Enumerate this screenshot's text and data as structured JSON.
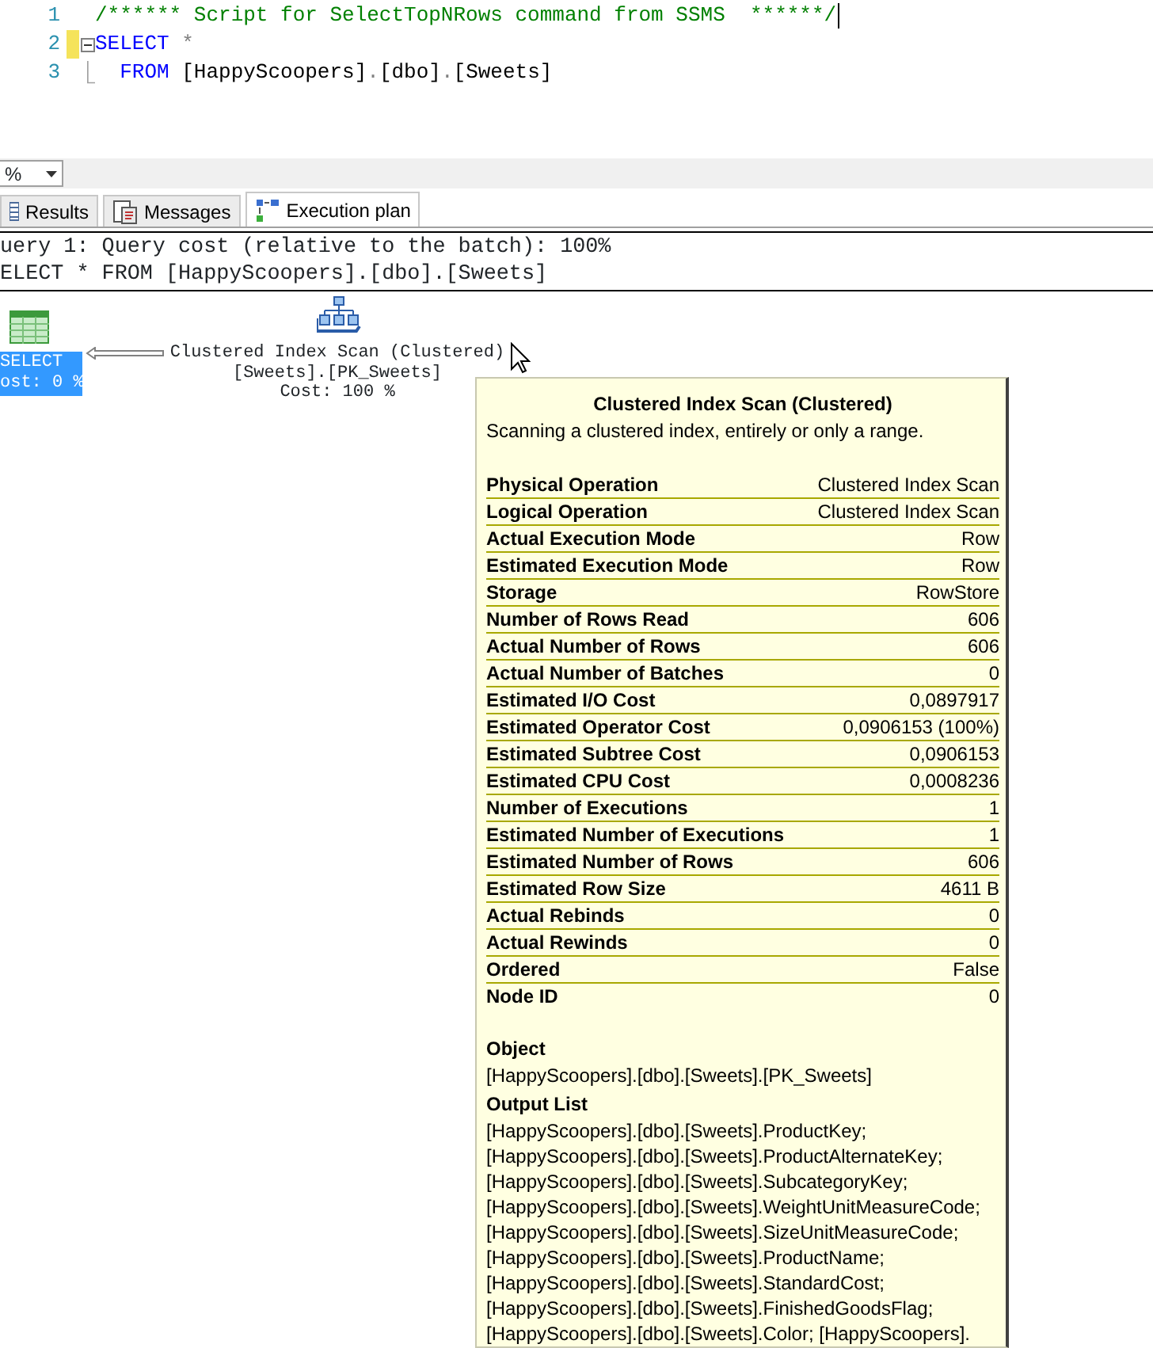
{
  "editor": {
    "lines": [
      {
        "number": "1",
        "modified": false,
        "collapse_box": false,
        "fold_guide": false,
        "caret": true,
        "segments": [
          {
            "kind": "comment",
            "text": "/****** Script for SelectTopNRows command from SSMS  ******/"
          }
        ]
      },
      {
        "number": "2",
        "modified": true,
        "collapse_box": true,
        "fold_guide": false,
        "caret": false,
        "segments": [
          {
            "kind": "keyword",
            "text": "SELECT"
          },
          {
            "kind": "operator",
            "text": " *"
          }
        ]
      },
      {
        "number": "3",
        "modified": false,
        "collapse_box": false,
        "fold_guide": true,
        "caret": false,
        "segments": [
          {
            "kind": "keyword",
            "text": "  FROM"
          },
          {
            "kind": "identifier",
            "text": " [HappyScoopers]"
          },
          {
            "kind": "operator",
            "text": "."
          },
          {
            "kind": "identifier",
            "text": "[dbo]"
          },
          {
            "kind": "operator",
            "text": "."
          },
          {
            "kind": "identifier",
            "text": "[Sweets]"
          }
        ]
      }
    ]
  },
  "zoom": {
    "value": "%"
  },
  "tabs": [
    {
      "label": "Results",
      "selected": false,
      "kind": "grid"
    },
    {
      "label": "Messages",
      "selected": false,
      "kind": "messages"
    },
    {
      "label": "Execution plan",
      "selected": true,
      "kind": "plan"
    }
  ],
  "plan": {
    "header": [
      "uery 1: Query cost (relative to the batch): 100%",
      "ELECT * FROM [HappyScoopers].[dbo].[Sweets]"
    ],
    "nodes": [
      {
        "kind": "select",
        "selected": true,
        "lines": [
          "SELECT",
          "ost: 0 %"
        ]
      },
      {
        "kind": "scan",
        "selected": false,
        "lines": [
          "Clustered Index Scan (Clustered)",
          "[Sweets].[PK_Sweets]",
          "Cost: 100 %"
        ]
      }
    ]
  },
  "tooltip": {
    "title": "Clustered Index Scan (Clustered)",
    "description": "Scanning a clustered index, entirely or only a range.",
    "properties": [
      {
        "label": "Physical Operation",
        "value": "Clustered Index Scan"
      },
      {
        "label": "Logical Operation",
        "value": "Clustered Index Scan"
      },
      {
        "label": "Actual Execution Mode",
        "value": "Row"
      },
      {
        "label": "Estimated Execution Mode",
        "value": "Row"
      },
      {
        "label": "Storage",
        "value": "RowStore"
      },
      {
        "label": "Number of Rows Read",
        "value": "606"
      },
      {
        "label": "Actual Number of Rows",
        "value": "606"
      },
      {
        "label": "Actual Number of Batches",
        "value": "0"
      },
      {
        "label": "Estimated I/O Cost",
        "value": "0,0897917"
      },
      {
        "label": "Estimated Operator Cost",
        "value": "0,0906153 (100%)"
      },
      {
        "label": "Estimated Subtree Cost",
        "value": "0,0906153"
      },
      {
        "label": "Estimated CPU Cost",
        "value": "0,0008236"
      },
      {
        "label": "Number of Executions",
        "value": "1"
      },
      {
        "label": "Estimated Number of Executions",
        "value": "1"
      },
      {
        "label": "Estimated Number of Rows",
        "value": "606"
      },
      {
        "label": "Estimated Row Size",
        "value": "4611 B"
      },
      {
        "label": "Actual Rebinds",
        "value": "0"
      },
      {
        "label": "Actual Rewinds",
        "value": "0"
      },
      {
        "label": "Ordered",
        "value": "False"
      },
      {
        "label": "Node ID",
        "value": "0"
      }
    ],
    "sections": [
      {
        "heading": "Object",
        "lines": [
          "[HappyScoopers].[dbo].[Sweets].[PK_Sweets]"
        ]
      },
      {
        "heading": "Output List",
        "lines": [
          "[HappyScoopers].[dbo].[Sweets].ProductKey;",
          "[HappyScoopers].[dbo].[Sweets].ProductAlternateKey;",
          "[HappyScoopers].[dbo].[Sweets].SubcategoryKey;",
          "[HappyScoopers].[dbo].[Sweets].WeightUnitMeasureCode;",
          "[HappyScoopers].[dbo].[Sweets].SizeUnitMeasureCode;",
          "[HappyScoopers].[dbo].[Sweets].ProductName;",
          "[HappyScoopers].[dbo].[Sweets].StandardCost;",
          "[HappyScoopers].[dbo].[Sweets].FinishedGoodsFlag;",
          "[HappyScoopers].[dbo].[Sweets].Color; [HappyScoopers]."
        ]
      }
    ]
  }
}
